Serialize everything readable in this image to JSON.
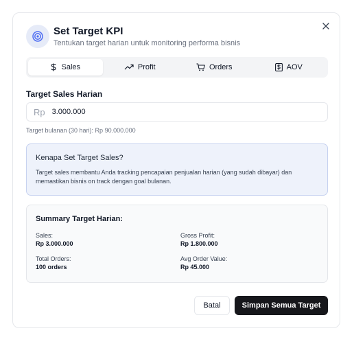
{
  "header": {
    "title": "Set Target KPI",
    "subtitle": "Tentukan target harian untuk monitoring performa bisnis",
    "icon": "target-icon",
    "close_icon": "close-icon"
  },
  "tabs": [
    {
      "label": "Sales",
      "icon": "dollar-icon",
      "active": true
    },
    {
      "label": "Profit",
      "icon": "trending-up-icon",
      "active": false
    },
    {
      "label": "Orders",
      "icon": "cart-icon",
      "active": false
    },
    {
      "label": "AOV",
      "icon": "receipt-dollar-icon",
      "active": false
    }
  ],
  "form": {
    "label": "Target Sales Harian",
    "prefix": "Rp",
    "value": "3.000.000",
    "helper": "Target bulanan (30 hari): Rp 90.000.000"
  },
  "info": {
    "title": "Kenapa Set Target Sales?",
    "body": "Target sales membantu Anda tracking pencapaian penjualan harian (yang sudah dibayar) dan memastikan bisnis on track dengan goal bulanan."
  },
  "summary": {
    "title": "Summary Target Harian:",
    "items": [
      {
        "label": "Sales:",
        "value": "Rp 3.000.000"
      },
      {
        "label": "Gross Profit:",
        "value": "Rp 1.800.000"
      },
      {
        "label": "Total Orders:",
        "value": "100 orders"
      },
      {
        "label": "Avg Order Value:",
        "value": "Rp 45.000"
      }
    ]
  },
  "actions": {
    "cancel_label": "Batal",
    "save_label": "Simpan Semua Target"
  },
  "colors": {
    "accent": "#4f6ef2",
    "info_bg": "#eef2fb",
    "primary_button": "#16171b"
  }
}
